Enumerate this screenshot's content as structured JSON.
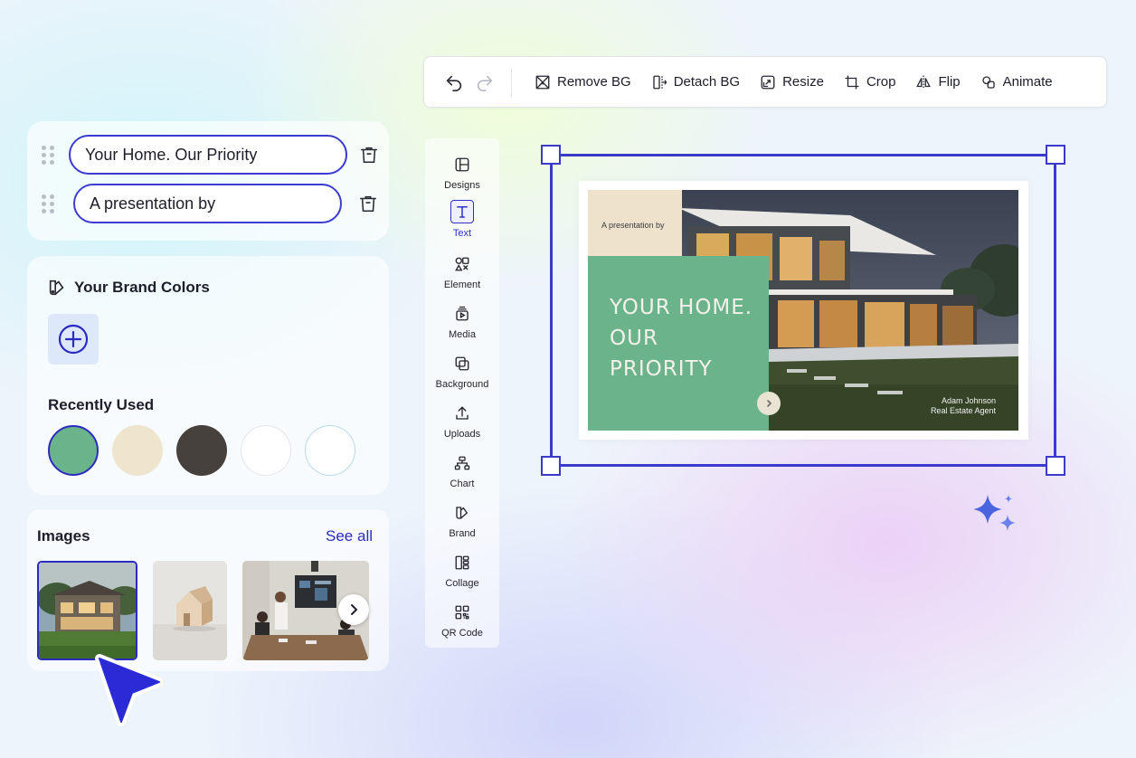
{
  "toolbar": {
    "undo_icon": "undo-icon",
    "redo_icon": "redo-icon",
    "buttons": [
      {
        "label": "Remove BG",
        "icon": "remove-bg-icon"
      },
      {
        "label": "Detach BG",
        "icon": "detach-bg-icon"
      },
      {
        "label": "Resize",
        "icon": "resize-icon"
      },
      {
        "label": "Crop",
        "icon": "crop-icon"
      },
      {
        "label": "Flip",
        "icon": "flip-icon"
      },
      {
        "label": "Animate",
        "icon": "animate-icon"
      }
    ]
  },
  "text_fields": [
    {
      "value": "Your Home. Our Priority"
    },
    {
      "value": "A presentation by"
    }
  ],
  "brand_colors": {
    "title": "Your Brand Colors",
    "recently_used_title": "Recently Used",
    "recent": [
      "#6bb48b",
      "#efe5cf",
      "#47413d",
      "#ffffff",
      "#ffffff"
    ]
  },
  "images": {
    "title": "Images",
    "see_all": "See all"
  },
  "rail": [
    {
      "label": "Designs",
      "icon": "designs-icon"
    },
    {
      "label": "Text",
      "icon": "text-icon",
      "active": true
    },
    {
      "label": "Element",
      "icon": "element-icon"
    },
    {
      "label": "Media",
      "icon": "media-icon"
    },
    {
      "label": "Background",
      "icon": "background-icon"
    },
    {
      "label": "Uploads",
      "icon": "upload-icon"
    },
    {
      "label": "Chart",
      "icon": "chart-icon"
    },
    {
      "label": "Brand",
      "icon": "brand-icon"
    },
    {
      "label": "Collage",
      "icon": "collage-icon"
    },
    {
      "label": "QR Code",
      "icon": "qr-code-icon"
    }
  ],
  "slide": {
    "pretitle": "A presentation by",
    "title": "Your Home. Our Priority",
    "name": "Adam Johnson",
    "role": "Real Estate Agent"
  },
  "colors": {
    "accent": "#3a3acb",
    "slide_green": "#6bb48b",
    "slide_beige": "#efe2cd"
  }
}
